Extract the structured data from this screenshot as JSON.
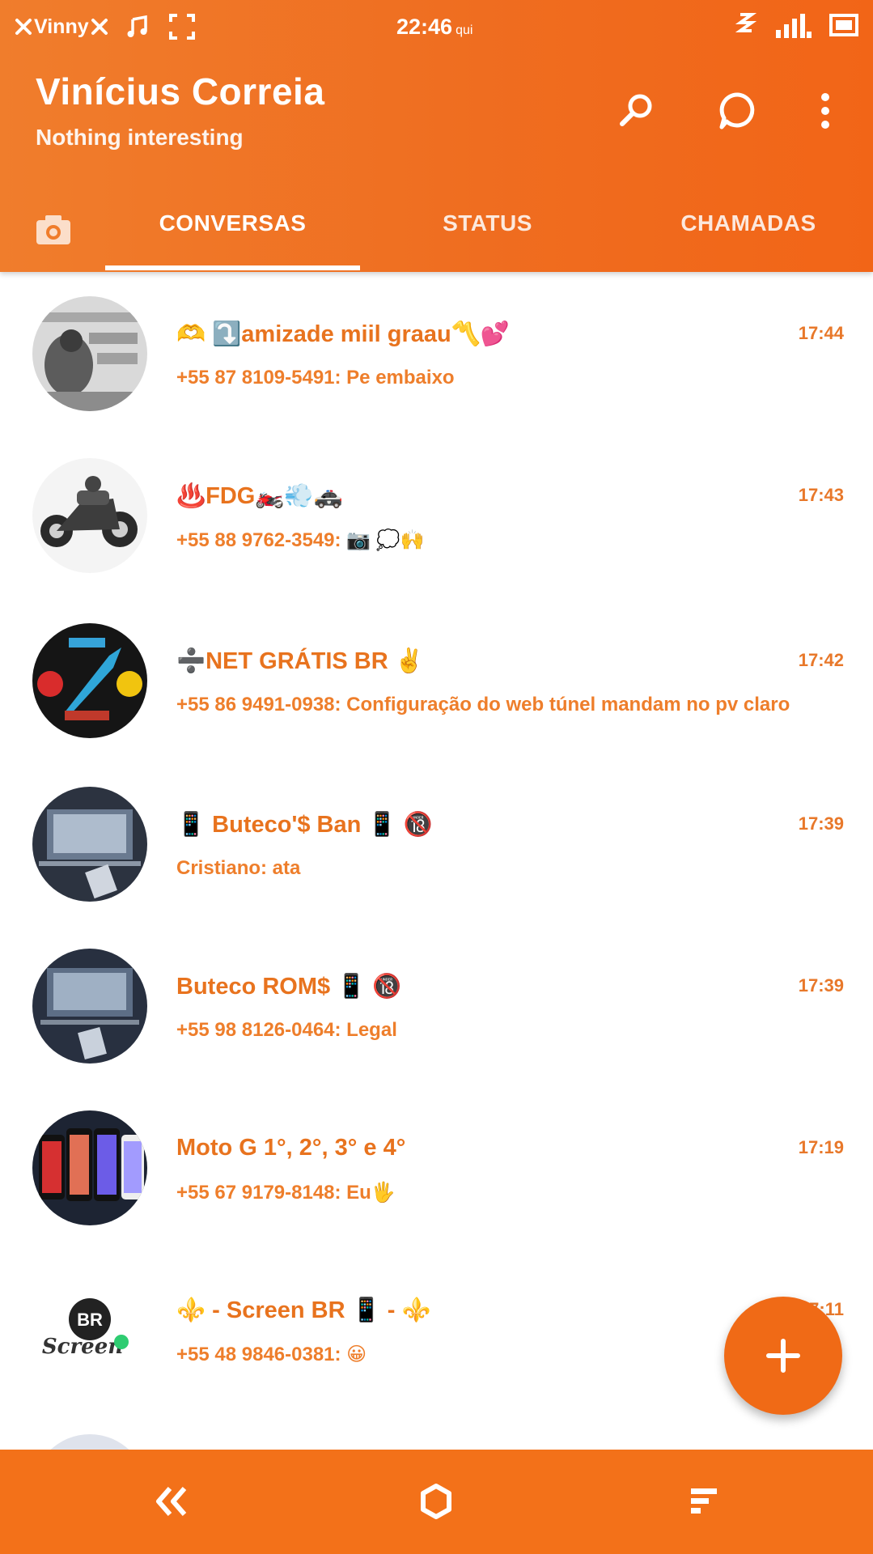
{
  "colors": {
    "accent": "#ef6d20",
    "text_orange": "#e8731e",
    "nav": "#f37119",
    "fab": "#f06a16"
  },
  "status_bar": {
    "carrier": "Vinny",
    "time": "22:46",
    "time_suffix": "qui",
    "icons": [
      "close-x-icon",
      "music-note-icon",
      "screenshot-frame-icon",
      "vibrate-icon",
      "signal-bars-icon",
      "battery-icon"
    ]
  },
  "header": {
    "name": "Vinícius Correia",
    "status": "Nothing interesting",
    "actions": [
      "search-icon",
      "new-chat-icon",
      "more-vert-icon"
    ]
  },
  "tabs": [
    {
      "label": "CONVERSAS",
      "active": true
    },
    {
      "label": "STATUS",
      "active": false
    },
    {
      "label": "CHAMADAS",
      "active": false
    }
  ],
  "chats": [
    {
      "title": "🫶 ⤵️amizade miil graau〽️💕",
      "preview": "+55 87 8109-5491: Pe embaixo",
      "time": "17:44"
    },
    {
      "title": "♨️FDG🏍️💨🚓",
      "preview": "+55 88 9762-3549: 📷 💭🙌",
      "time": "17:43"
    },
    {
      "title": "➗NET GRÁTIS BR ✌️",
      "preview": "+55 86 9491-0938: Configuração do web túnel mandam no pv claro",
      "time": "17:42"
    },
    {
      "title": "📱 Buteco'$ Ban 📱 🔞",
      "preview": "Cristiano: ata",
      "time": "17:39"
    },
    {
      "title": "Buteco ROM$ 📱 🔞",
      "preview": "+55 98 8126-0464: Legal",
      "time": "17:39"
    },
    {
      "title": "Moto G 1°, 2°, 3° e 4°",
      "preview": "+55 67 9179-8148: Eu🖐️",
      "time": "17:19"
    },
    {
      "title": "⚜️ - Screen BR 📱 - ⚜️",
      "preview": "+55 48 9846-0381: 😀",
      "time": "17:11"
    }
  ],
  "fab": {
    "icon": "plus-icon"
  },
  "bottom_nav": [
    "back-icon",
    "home-icon",
    "recents-icon"
  ]
}
